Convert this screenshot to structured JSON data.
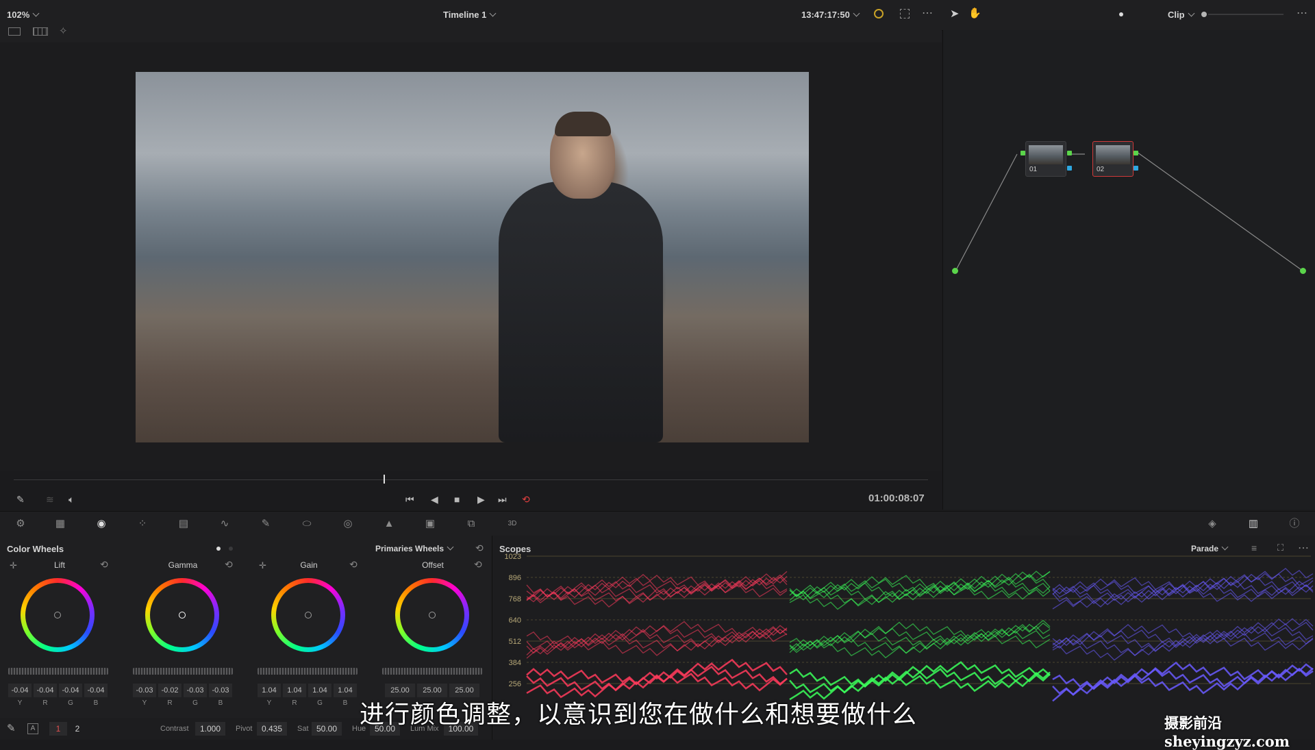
{
  "topbar": {
    "zoom": "102%",
    "timeline": "Timeline 1",
    "timecode": "13:47:17:50",
    "clip": "Clip"
  },
  "viewer": {
    "timecode": "01:00:08:07"
  },
  "nodes": [
    {
      "label": "01"
    },
    {
      "label": "02"
    }
  ],
  "wheels_panel": {
    "title": "Color Wheels",
    "mode": "Primaries Wheels",
    "wheels": [
      {
        "name": "Lift",
        "values": [
          "-0.04",
          "-0.04",
          "-0.04",
          "-0.04"
        ]
      },
      {
        "name": "Gamma",
        "values": [
          "-0.03",
          "-0.02",
          "-0.03",
          "-0.03"
        ]
      },
      {
        "name": "Gain",
        "values": [
          "1.04",
          "1.04",
          "1.04",
          "1.04"
        ]
      },
      {
        "name": "Offset",
        "values": [
          "25.00",
          "25.00",
          "25.00"
        ]
      }
    ],
    "channels_ygrb": [
      "Y",
      "R",
      "G",
      "B"
    ],
    "channels_rgb": [
      "R",
      "G",
      "B"
    ]
  },
  "bottom_strip": {
    "page1": "1",
    "page2": "2",
    "contrast_label": "Contrast",
    "contrast": "1.000",
    "pivot_label": "Pivot",
    "pivot": "0.435",
    "sat_label": "Sat",
    "sat": "50.00",
    "hue_label": "Hue",
    "hue": "50.00",
    "lummix_label": "Lum Mix",
    "lummix": "100.00"
  },
  "scopes": {
    "title": "Scopes",
    "mode": "Parade",
    "scale": [
      "1023",
      "896",
      "768",
      "640",
      "512",
      "384",
      "256"
    ],
    "colors": {
      "red": "#ff3b5c",
      "green": "#3bff5a",
      "blue": "#6a5bff"
    }
  },
  "subtitle": "进行颜色调整，以意识到您在做什么和想要做什么",
  "watermark": "摄影前沿sheyingzyz.com"
}
